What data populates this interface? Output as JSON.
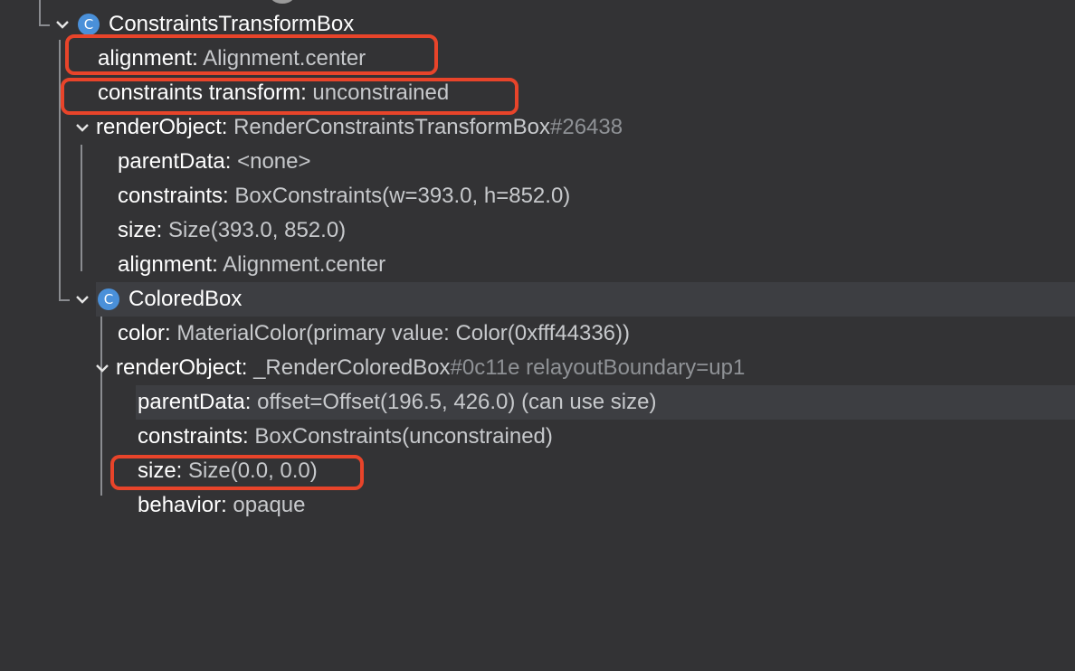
{
  "tree": {
    "rows": [
      {
        "kind": "node",
        "name": "ConstraintsTransformBox",
        "badge": "C"
      },
      {
        "kind": "prop",
        "key": "alignment:",
        "value": "Alignment.center"
      },
      {
        "kind": "prop",
        "key": "constraints transform:",
        "value": "unconstrained"
      },
      {
        "kind": "prop",
        "key": "renderObject:",
        "value": "RenderConstraintsTransformBox",
        "suffix": "#26438"
      },
      {
        "kind": "prop",
        "key": "parentData:",
        "value": "<none>"
      },
      {
        "kind": "prop",
        "key": "constraints:",
        "value": "BoxConstraints(w=393.0, h=852.0)"
      },
      {
        "kind": "prop",
        "key": "size:",
        "value": "Size(393.0, 852.0)"
      },
      {
        "kind": "prop",
        "key": "alignment:",
        "value": "Alignment.center"
      },
      {
        "kind": "node",
        "name": "ColoredBox",
        "badge": "C"
      },
      {
        "kind": "prop",
        "key": "color:",
        "value": "MaterialColor(primary value: Color(0xfff44336))"
      },
      {
        "kind": "prop",
        "key": "renderObject:",
        "value": "_RenderColoredBox",
        "suffix": "#0c11e relayoutBoundary=up1"
      },
      {
        "kind": "prop",
        "key": "parentData:",
        "value": "offset=Offset(196.5, 426.0) (can use size)"
      },
      {
        "kind": "prop",
        "key": "constraints:",
        "value": "BoxConstraints(unconstrained)"
      },
      {
        "kind": "prop",
        "key": "size:",
        "value": "Size(0.0, 0.0)"
      },
      {
        "kind": "prop",
        "key": "behavior:",
        "value": "opaque"
      }
    ]
  },
  "colors": {
    "background": "#333335",
    "row_highlight": "#3d3e42",
    "key_text": "#ffffff",
    "value_text": "#c7c9cc",
    "dim_text": "#8f9296",
    "badge": "#4a90d9",
    "callout": "#e8442a",
    "tree_lines": "#8a8c90"
  },
  "icons": {
    "expand": "chevron-down-icon",
    "class_badge": "class-c-badge-icon"
  }
}
